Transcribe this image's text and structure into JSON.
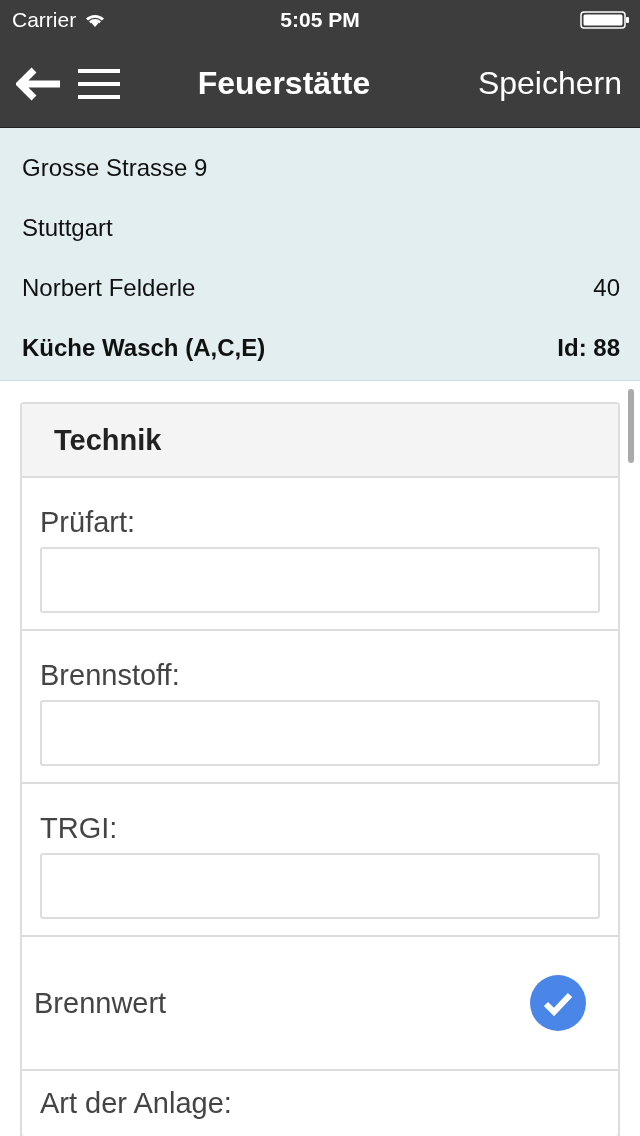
{
  "status_bar": {
    "carrier": "Carrier",
    "time": "5:05 PM"
  },
  "nav": {
    "title": "Feuerstätte",
    "action": "Speichern"
  },
  "info": {
    "street": "Grosse Strasse 9",
    "city": "Stuttgart",
    "owner": "Norbert Felderle",
    "owner_number": "40",
    "location": "Küche Wasch (A,C,E)",
    "id": "Id: 88"
  },
  "section": {
    "title": "Technik",
    "fields": [
      {
        "kind": "text",
        "label": "Prüfart:"
      },
      {
        "kind": "text",
        "label": "Brennstoff:"
      },
      {
        "kind": "text",
        "label": "TRGI:"
      },
      {
        "kind": "check",
        "label": "Brennwert",
        "checked": true
      },
      {
        "kind": "label",
        "label": "Art der Anlage:"
      }
    ]
  }
}
